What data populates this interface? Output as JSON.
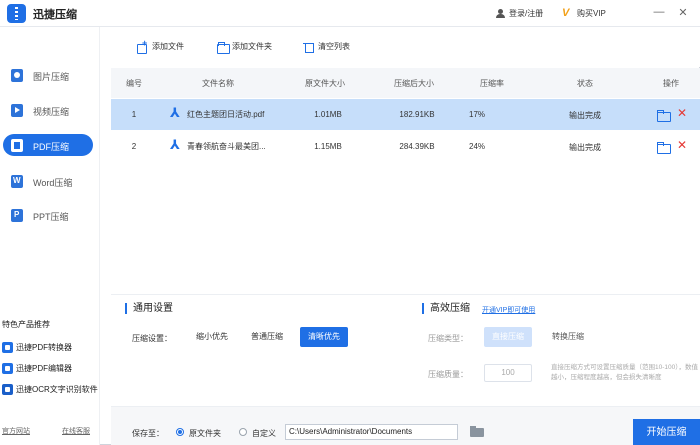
{
  "app": {
    "title": "迅捷压缩"
  },
  "titlebar": {
    "login": "登录/注册",
    "vip": "购买VIP",
    "minimize_glyph": "—",
    "close_glyph": "✕"
  },
  "sidebar": {
    "items": [
      {
        "label": "图片压缩",
        "icon": "image-icon",
        "active": false
      },
      {
        "label": "视频压缩",
        "icon": "video-icon",
        "active": false
      },
      {
        "label": "PDF压缩",
        "icon": "pdf-icon",
        "active": true
      },
      {
        "label": "Word压缩",
        "icon": "word-icon",
        "active": false
      },
      {
        "label": "PPT压缩",
        "icon": "ppt-icon",
        "active": false
      }
    ],
    "promo_title": "特色产品推荐",
    "promo_items": [
      "迅捷PDF转换器",
      "迅捷PDF编辑器",
      "迅捷OCR文字识别软件"
    ],
    "footer_links": [
      "官方网站",
      "在线客服"
    ]
  },
  "toolbar": {
    "add_file": "添加文件",
    "add_folder": "添加文件夹",
    "clear_list": "清空列表"
  },
  "table": {
    "headers": [
      "编号",
      "文件名称",
      "原文件大小",
      "压缩后大小",
      "压缩率",
      "状态",
      "操作"
    ],
    "rows": [
      {
        "index": "1",
        "name": "红色主题团日活动.pdf",
        "original": "1.01MB",
        "compressed": "182.91KB",
        "ratio": "17%",
        "status": "输出完成"
      },
      {
        "index": "2",
        "name": "青春领航奋斗最美团...",
        "original": "1.15MB",
        "compressed": "284.39KB",
        "ratio": "24%",
        "status": "输出完成"
      }
    ]
  },
  "settings": {
    "general_title": "通用设置",
    "compress_label": "压缩设置：",
    "options": [
      "缩小优先",
      "普通压缩",
      "清晰优先"
    ],
    "selected_option": "清晰优先",
    "efficient_title": "高效压缩",
    "vip_link": "开通VIP即可使用",
    "type_label": "压缩类型：",
    "type_options": [
      "直接压缩",
      "转换压缩"
    ],
    "quality_label": "压缩质量：",
    "quality_value": "100",
    "hint": "直接压缩方式可设置压缩质量（范围10-100），数值越小，压缩程度越高，但会损失清晰度"
  },
  "footer": {
    "save_to": "保存至：",
    "original_folder": "原文件夹",
    "custom": "自定义",
    "path": "C:\\Users\\Administrator\\Documents",
    "start": "开始压缩"
  }
}
